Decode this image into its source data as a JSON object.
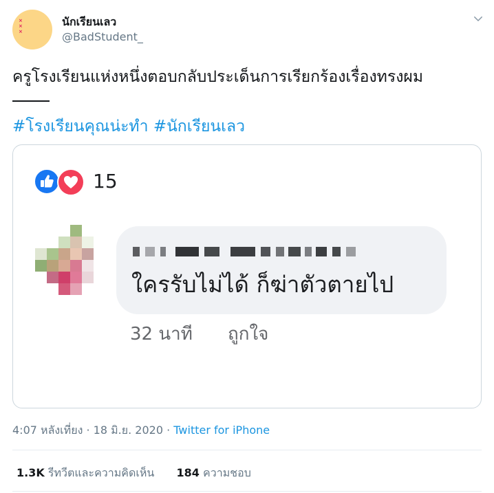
{
  "tweet": {
    "display_name": "นักเรียนเลว",
    "handle": "@BadStudent_",
    "avatar_icon": "avatar-image",
    "menu_icon": "chevron-down-icon",
    "text": "ครูโรงเรียนแห่งหนึ่งตอบกลับประเด็นการเรียกร้องเรื่องทรงผม",
    "hashtags": [
      "#โรงเรียนคุณน่ะทำ",
      "#นักเรียนเลว"
    ],
    "accent_color": "#1b95e0"
  },
  "media": {
    "reaction_count": "15",
    "reaction_icons": [
      "like-icon",
      "love-icon"
    ],
    "comment_text": "ใครรับไม่ได้  ก็ฆ่าตัวตายไป",
    "comment_time": "32 นาที",
    "comment_like_label": "ถูกใจ"
  },
  "meta": {
    "time": "4:07 หลังเที่ยง",
    "separator": "·",
    "date": "18 มิ.ย. 2020",
    "source": "Twitter for iPhone"
  },
  "stats": {
    "retweets_count": "1.3K",
    "retweets_label": "รีทวีตและความคิดเห็น",
    "likes_count": "184",
    "likes_label": "ความชอบ"
  }
}
